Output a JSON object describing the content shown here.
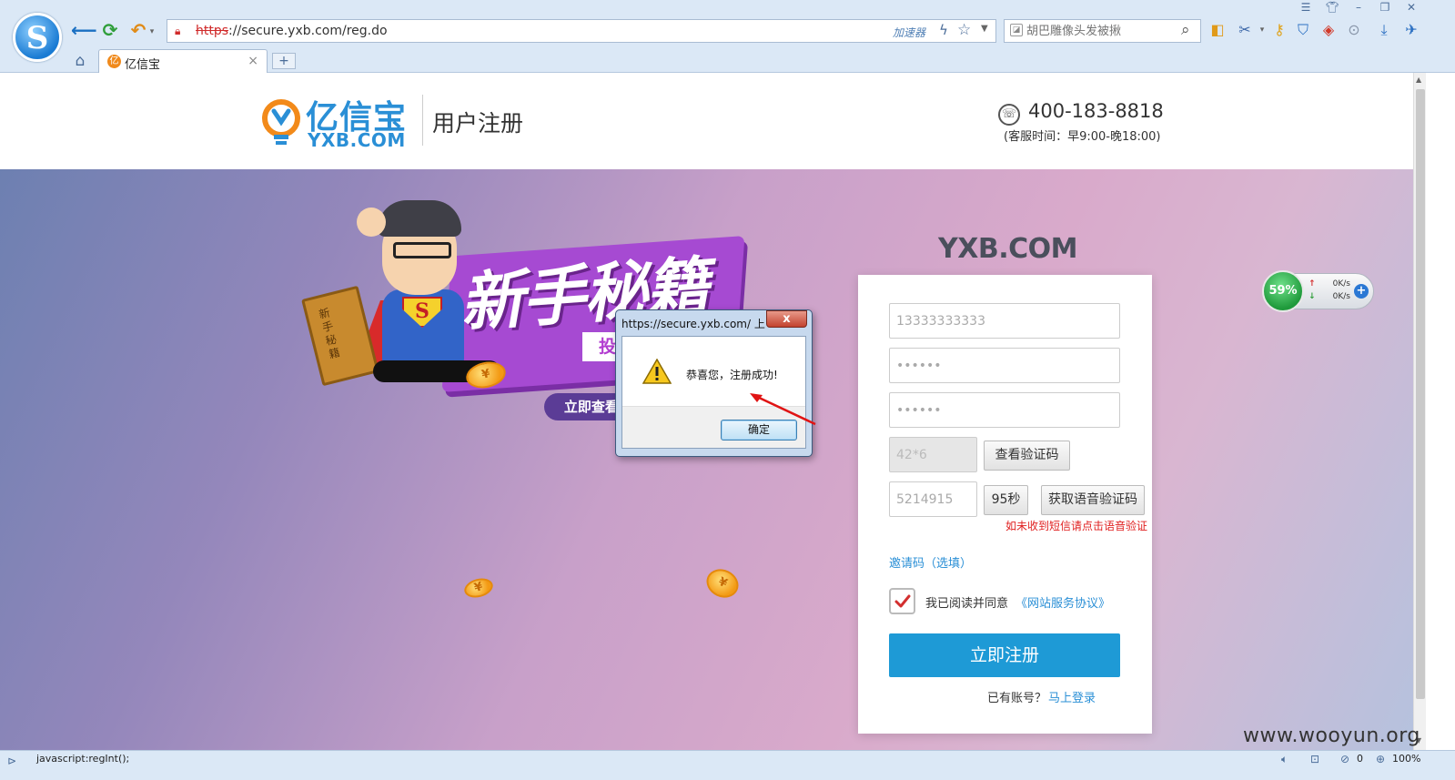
{
  "browser": {
    "logo_letter": "S",
    "url_scheme": "https",
    "url_rest": "://secure.yxb.com/reg.do",
    "accelerator_label": "加速器",
    "search_placeholder": "胡巴雕像头发被揪",
    "tab_title": "亿信宝",
    "tab_favicon": "亿",
    "tab_close": "×",
    "new_tab": "+",
    "icons": {
      "back": "back-arrow-icon",
      "refresh": "refresh-icon",
      "undo": "undo-icon",
      "home": "home-icon",
      "lock": "lock-broken-icon",
      "star": "star-icon",
      "search": "search-icon"
    }
  },
  "header": {
    "logo_cn": "亿信宝",
    "logo_en": "YXB.COM",
    "page_title": "用户注册",
    "phone": "400-183-8818",
    "service_hours": "(客服时间：早9:00-晚18:00)"
  },
  "banner": {
    "wordmark": "YXB.COM",
    "promo_title": "新手秘籍",
    "promo_subtitle": "投资原来如此简单",
    "promo_button": "立即查看 ＞",
    "book_text": "新手秘籍",
    "coin_symbol": "¥"
  },
  "form": {
    "phone_value": "13333333333",
    "password_value": "••••••",
    "confirm_password_value": "••••••",
    "captcha_value": "42*6",
    "show_captcha_button": "查看验证码",
    "sms_code_value": "5214915",
    "countdown_button": "95秒",
    "voice_code_button": "获取语音验证码",
    "sms_hint": "如未收到短信请点击语音验证",
    "invite_link": "邀请码（选填）",
    "agree_checked": true,
    "agree_text": "我已阅读并同意",
    "agree_link": "《网站服务协议》",
    "submit_button": "立即注册",
    "have_account": "已有账号？",
    "login_link": "马上登录"
  },
  "speed_widget": {
    "percent": "59%",
    "upload": "0K/s",
    "download": "0K/s",
    "plus": "+"
  },
  "alert": {
    "title": "https://secure.yxb.com/ 上...",
    "close_label": "x",
    "message": "恭喜您，注册成功!",
    "ok_button": "确定"
  },
  "watermark": "www.wooyun.org",
  "status_bar": {
    "text": "javascript:regInt();",
    "count": "0",
    "zoom": "100%"
  },
  "colors": {
    "brand_blue": "#2a8fd6",
    "submit_blue": "#1e9ad6",
    "hint_red": "#e02020",
    "promo_purple": "#a64ad2"
  }
}
